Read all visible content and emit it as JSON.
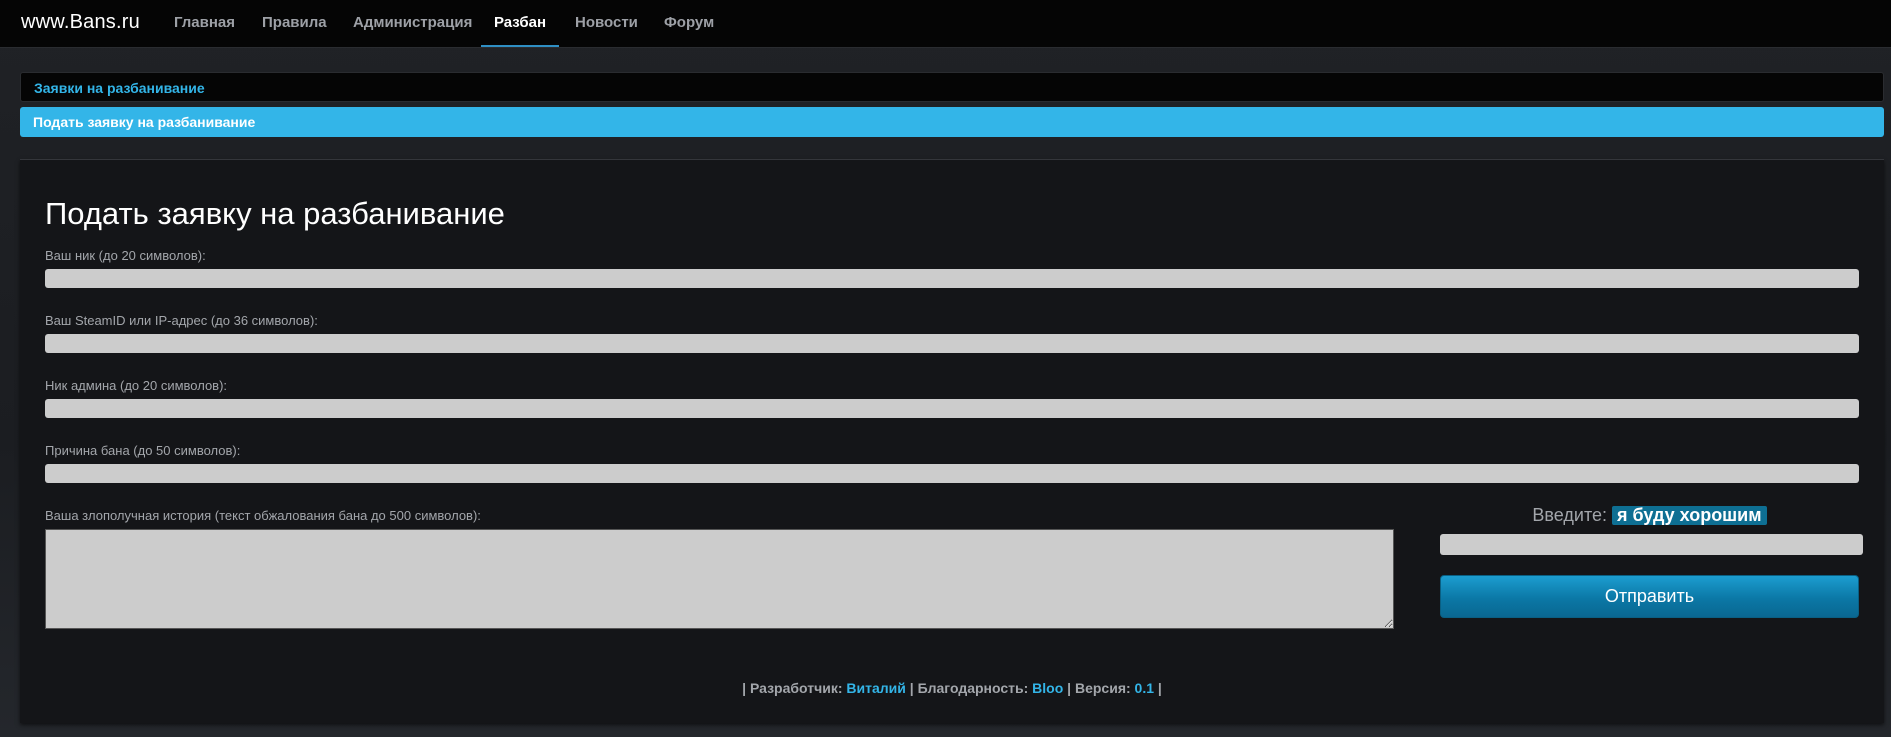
{
  "brand": "www.Bans.ru",
  "nav": [
    {
      "label": "Главная",
      "active": false
    },
    {
      "label": "Правила",
      "active": false
    },
    {
      "label": "Администрация",
      "active": false
    },
    {
      "label": "Разбан",
      "active": true
    },
    {
      "label": "Новости",
      "active": false
    },
    {
      "label": "Форум",
      "active": false
    }
  ],
  "subnav": [
    {
      "label": "Заявки на разбанивание",
      "active": false
    },
    {
      "label": "Подать заявку на разбанивание",
      "active": true
    }
  ],
  "form": {
    "title": "Подать заявку на разбанивание",
    "nick_label": "Ваш ник (до 20 символов):",
    "nick_value": "",
    "steam_label": "Ваш SteamID или IP-адрес (до 36 символов):",
    "steam_value": "",
    "admin_label": "Ник админа (до 20 символов):",
    "admin_value": "",
    "reason_label": "Причина бана (до 50 символов):",
    "reason_value": "",
    "story_label": "Ваша злополучная история (текст обжалования бана до 500 символов):",
    "story_value": "",
    "captcha_prompt": "Введите:",
    "captcha_word": "я буду хорошим",
    "captcha_value": "",
    "submit_label": "Отправить"
  },
  "footer": {
    "sep": "|",
    "dev_label": "Разработчик:",
    "dev_name": "Виталий",
    "thanks_label": "Благодарность:",
    "thanks_name": "Bloo",
    "version_label": "Версия:",
    "version_value": "0.1"
  },
  "colors": {
    "accent": "#33b5e8",
    "navbar": "#050505",
    "panel": "#141518",
    "button": "#0b78a6"
  }
}
